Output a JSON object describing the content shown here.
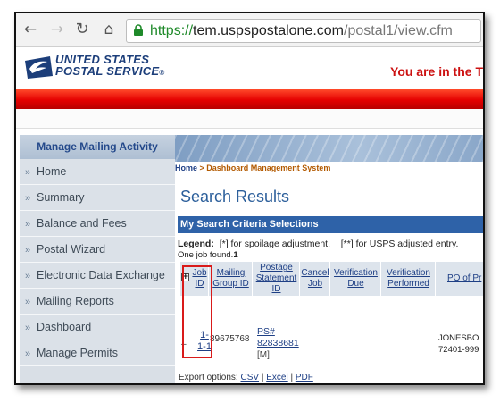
{
  "browser": {
    "url_scheme": "https://",
    "url_host": "tem.uspspostalone.com",
    "url_path": "/postal1/view.cfm"
  },
  "header": {
    "brand_line1": "UNITED STATES",
    "brand_line2": "POSTAL SERVICE",
    "registered": "®",
    "tagline": "You are in the T"
  },
  "sidebar": {
    "title": "Manage Mailing Activity",
    "items": [
      {
        "label": "Home"
      },
      {
        "label": "Summary"
      },
      {
        "label": "Balance and Fees"
      },
      {
        "label": "Postal Wizard"
      },
      {
        "label": "Electronic Data Exchange"
      },
      {
        "label": "Mailing Reports"
      },
      {
        "label": "Dashboard"
      },
      {
        "label": "Manage Permits"
      }
    ]
  },
  "breadcrumb": {
    "home": "Home",
    "separator": " > ",
    "current": "Dashboard Management System"
  },
  "page_title": "Search Results",
  "criteria_title": "My Search Criteria Selections",
  "legend": {
    "label": "Legend:",
    "item1": "[*] for spoilage adjustment.",
    "item2": "[**] for USPS adjusted entry."
  },
  "jobs_found": {
    "prefix": "One job found.",
    "count": "1"
  },
  "table": {
    "expand_all": "+",
    "columns": [
      {
        "label": "Job ID"
      },
      {
        "label": "Mailing Group ID"
      },
      {
        "label": "Postage Statement ID"
      },
      {
        "label": "Cancel Job"
      },
      {
        "label": "Verification Due"
      },
      {
        "label": "Verification Performed"
      },
      {
        "label": "PO of Pr"
      }
    ],
    "row": {
      "collapse": "–",
      "job_id_line1": "1-",
      "job_id_line2": "1-1",
      "group_id": "89675768",
      "ps_line1": "PS#",
      "ps_line2": "82838681",
      "ps_mark": "[M]",
      "po_line1": "JONESBO",
      "po_line2": "72401-999"
    }
  },
  "export": {
    "label": "Export options:",
    "csv": "CSV",
    "excel": "Excel",
    "pdf": "PDF",
    "sep": " | "
  },
  "colors": {
    "usps_blue": "#1c3e7a",
    "red_bar": "#e40000",
    "criteria_bar": "#2e62a8",
    "highlight": "#d91a1a"
  }
}
